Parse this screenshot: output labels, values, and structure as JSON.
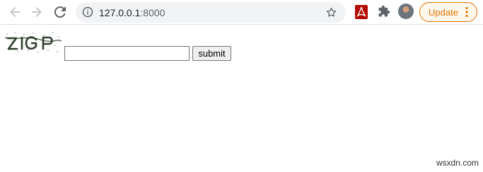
{
  "browser": {
    "url_host": "127.0.0.1",
    "url_port": ":8000",
    "update_label": "Update",
    "accent_color": "#e37400"
  },
  "icons": [
    "back-icon",
    "forward-icon",
    "reload-icon",
    "info-icon",
    "star-icon",
    "pdf-extension-icon",
    "puzzle-extensions-icon",
    "profile-avatar",
    "more-vert-icon"
  ],
  "form": {
    "captcha_text": "ZIGP",
    "input_value": "",
    "submit_label": "submit"
  },
  "watermark": "wsxdn.com"
}
